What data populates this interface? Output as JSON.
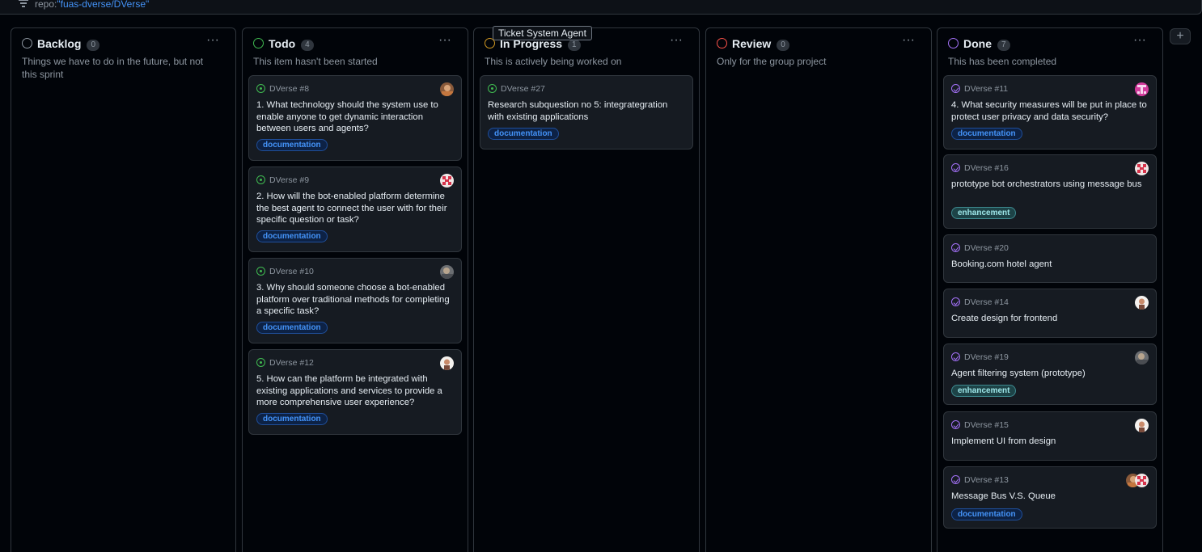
{
  "filter": {
    "prefix": "repo:",
    "value": "\"fuas-dverse/DVerse\""
  },
  "tooltip": "Ticket System Agent",
  "add_column_label": "+",
  "columns": [
    {
      "title": "Backlog",
      "count": "0",
      "status_color": "#8d96a0",
      "menu": "···",
      "description": "Things we have to do in the future, but not this sprint",
      "cards": []
    },
    {
      "title": "Todo",
      "count": "4",
      "status_color": "#3fb950",
      "menu": "···",
      "description": "This item hasn't been started",
      "cards": [
        {
          "ref": "DVerse #8",
          "title": "1. What technology should the system use to enable anyone to get dynamic interaction between users and agents?",
          "label": "documentation",
          "icon": "open-issue-icon"
        },
        {
          "ref": "DVerse #9",
          "title": "2. How will the bot-enabled platform determine the best agent to connect the user with for their specific question or task?",
          "label": "documentation",
          "icon": "open-issue-icon"
        },
        {
          "ref": "DVerse #10",
          "title": "3. Why should someone choose a bot-enabled platform over traditional methods for completing a specific task?",
          "label": "documentation",
          "icon": "open-issue-icon"
        },
        {
          "ref": "DVerse #12",
          "title": "5. How can the platform be integrated with existing applications and services to provide a more comprehensive user experience?",
          "label": "documentation",
          "icon": "open-issue-icon"
        }
      ]
    },
    {
      "title": "In Progress",
      "count": "1",
      "status_color": "#d29922",
      "menu": "···",
      "description": "This is actively being worked on",
      "cards": [
        {
          "ref": "DVerse #27",
          "title": "Research subquestion no 5: integrategration with existing applications",
          "label": "documentation",
          "icon": "open-issue-icon"
        }
      ]
    },
    {
      "title": "Review",
      "count": "0",
      "status_color": "#f85149",
      "menu": "···",
      "description": "Only for the group project",
      "cards": []
    },
    {
      "title": "Done",
      "count": "7",
      "status_color": "#a371f7",
      "menu": "···",
      "description": "This has been completed",
      "cards": [
        {
          "ref": "DVerse #11",
          "title": "4. What security measures will be put in place to protect user privacy and data security?",
          "label": "documentation",
          "icon": "closed-issue-icon"
        },
        {
          "ref": "DVerse #16",
          "title": "prototype bot orchestrators using message bus",
          "label": "enhancement",
          "icon": "closed-issue-icon"
        },
        {
          "ref": "DVerse #20",
          "title": "Booking.com hotel agent",
          "label": "",
          "icon": "closed-issue-icon"
        },
        {
          "ref": "DVerse #14",
          "title": "Create design for frontend",
          "label": "",
          "icon": "closed-issue-icon"
        },
        {
          "ref": "DVerse #19",
          "title": "Agent filtering system (prototype)",
          "label": "enhancement",
          "icon": "closed-issue-icon"
        },
        {
          "ref": "DVerse #15",
          "title": "Implement UI from design",
          "label": "",
          "icon": "closed-issue-icon"
        },
        {
          "ref": "DVerse #13",
          "title": "Message Bus V.S. Queue",
          "label": "documentation",
          "icon": "closed-issue-icon"
        }
      ]
    }
  ]
}
